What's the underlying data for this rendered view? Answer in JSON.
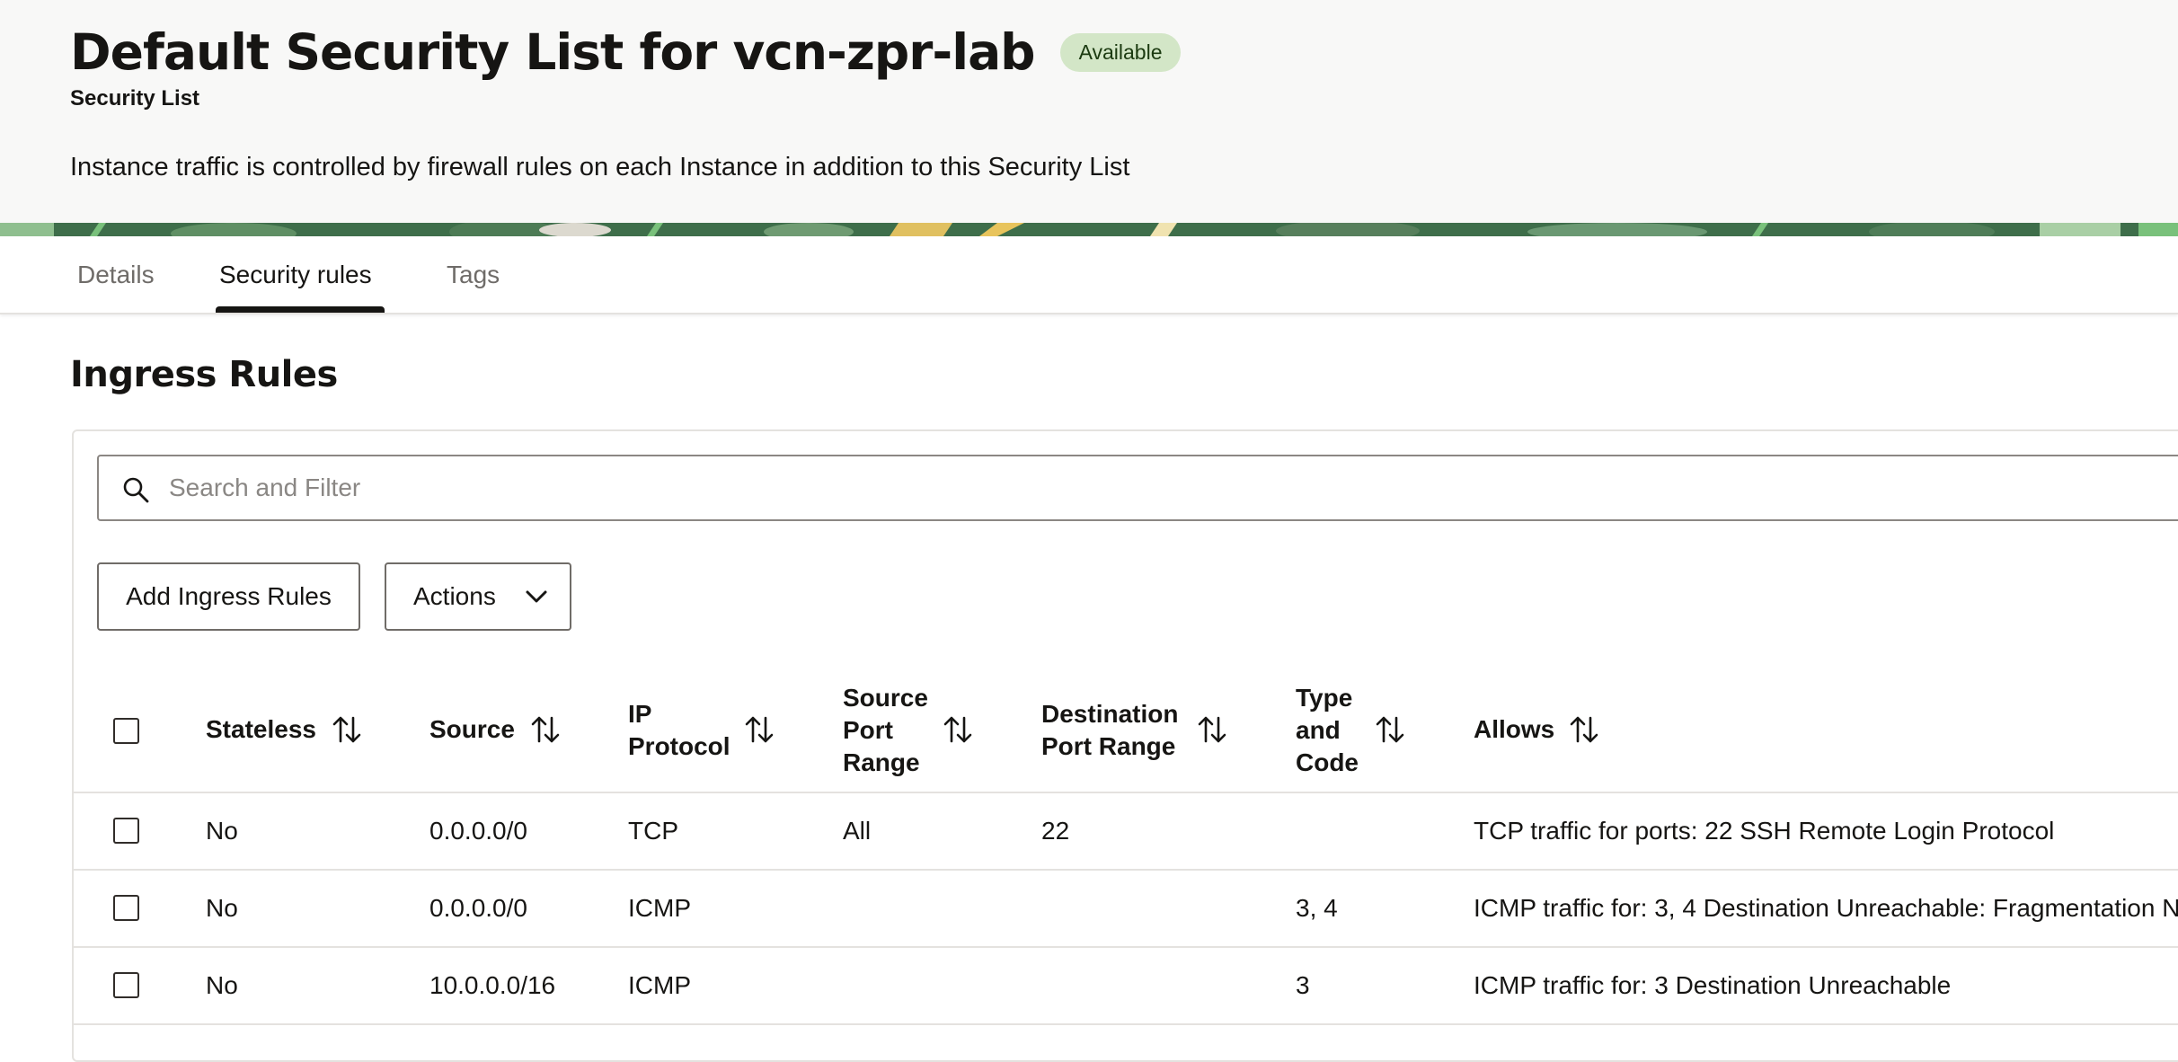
{
  "header": {
    "title": "Default Security List for vcn-zpr-lab",
    "status": "Available",
    "subtitle": "Security List",
    "description": "Instance traffic is controlled by firewall rules on each Instance in addition to this Security List"
  },
  "tabs": [
    {
      "label": "Details",
      "active": false
    },
    {
      "label": "Security rules",
      "active": true
    },
    {
      "label": "Tags",
      "active": false
    }
  ],
  "section": {
    "title": "Ingress Rules"
  },
  "search": {
    "placeholder": "Search and Filter"
  },
  "toolbar": {
    "add_label": "Add Ingress Rules",
    "actions_label": "Actions"
  },
  "table": {
    "columns": [
      {
        "label": "Stateless"
      },
      {
        "label": "Source"
      },
      {
        "label": "IP",
        "label2": "Protocol"
      },
      {
        "label": "Source",
        "label2": "Port",
        "label3": "Range"
      },
      {
        "label": "Destination",
        "label2": "Port Range"
      },
      {
        "label": "Type",
        "label2": "and",
        "label3": "Code"
      },
      {
        "label": "Allows"
      }
    ],
    "rows": [
      {
        "stateless": "No",
        "source": "0.0.0.0/0",
        "protocol": "TCP",
        "source_port": "All",
        "dest_port": "22",
        "type_code": "",
        "allows": "TCP traffic for ports: 22 SSH Remote Login Protocol"
      },
      {
        "stateless": "No",
        "source": "0.0.0.0/0",
        "protocol": "ICMP",
        "source_port": "",
        "dest_port": "",
        "type_code": "3, 4",
        "allows": "ICMP traffic for: 3, 4 Destination Unreachable: Fragmentation N"
      },
      {
        "stateless": "No",
        "source": "10.0.0.0/16",
        "protocol": "ICMP",
        "source_port": "",
        "dest_port": "",
        "type_code": "3",
        "allows": "ICMP traffic for: 3 Destination Unreachable"
      }
    ]
  },
  "colors": {
    "badge_bg": "#d3e6c7",
    "header_bg": "#f8f8f7",
    "banner": "#3e6e4a"
  },
  "icons": [
    "search-icon",
    "chevron-down-icon",
    "sort-icon"
  ]
}
